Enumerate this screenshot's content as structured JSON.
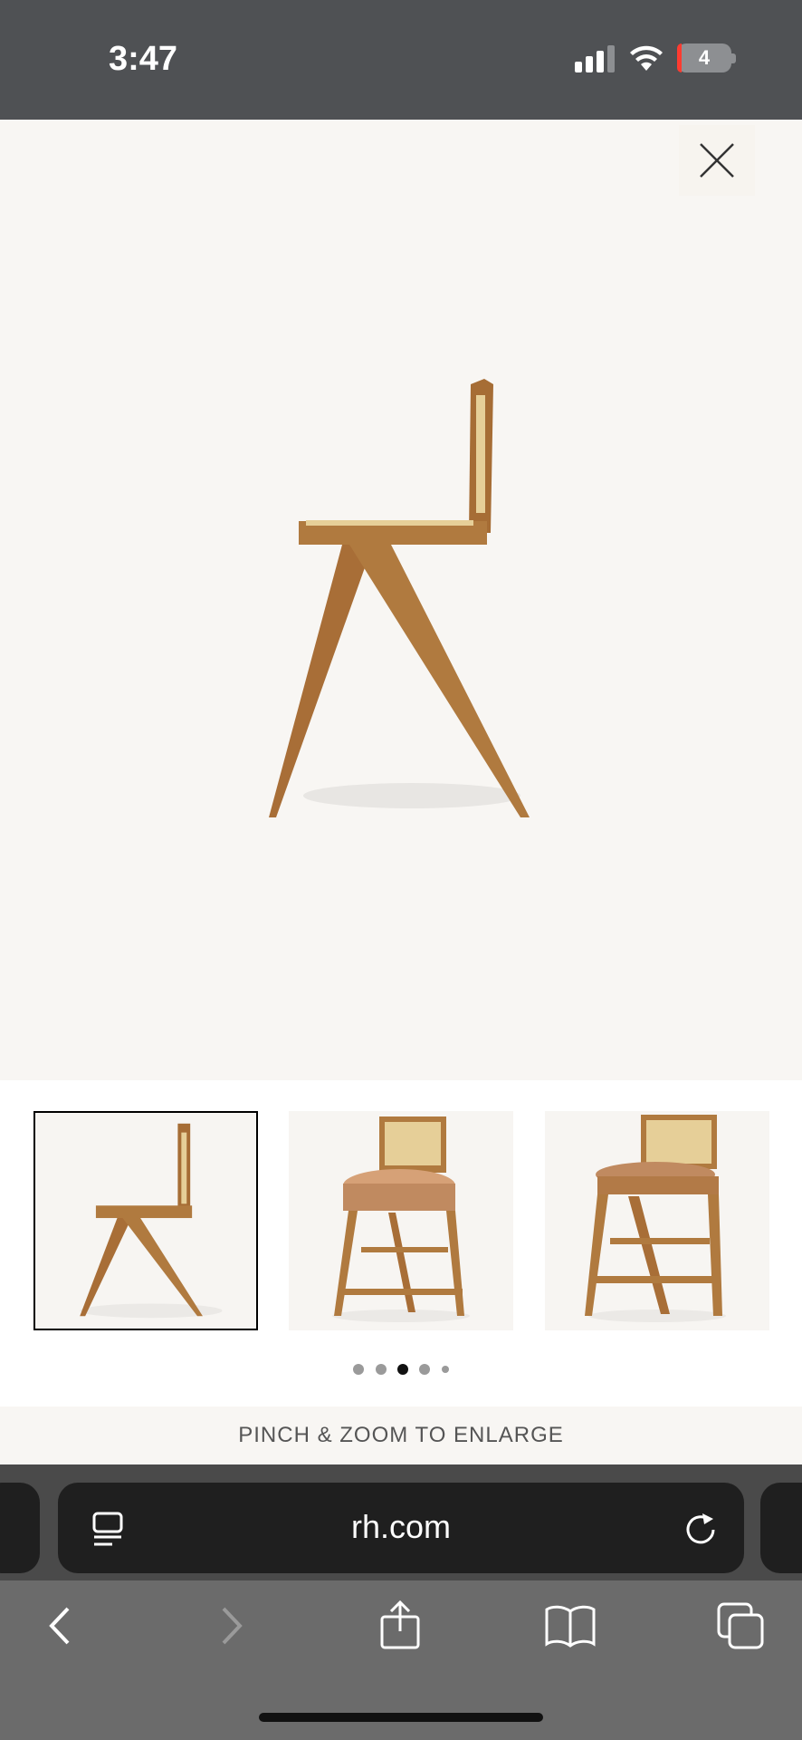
{
  "status_bar": {
    "time": "3:47",
    "battery_level": "4"
  },
  "viewer": {
    "close_icon": "close-icon",
    "main_image_alt": "side-view-cane-counter-stool"
  },
  "thumbnails": [
    {
      "name": "stool-side-view",
      "active": true
    },
    {
      "name": "stool-cushion-front",
      "active": false
    },
    {
      "name": "stool-cushion-angle",
      "active": false
    }
  ],
  "pager": {
    "total": 5,
    "active_index": 2
  },
  "hint": {
    "text": "PINCH & ZOOM TO ENLARGE"
  },
  "browser": {
    "url": "rh.com",
    "icons": [
      "reader-icon",
      "reload-icon",
      "back-icon",
      "forward-icon",
      "share-icon",
      "bookmarks-icon",
      "tabs-icon"
    ]
  },
  "colors": {
    "wood": "#b07a3f",
    "cane": "#e6cf98",
    "cushion": "#c08a60"
  }
}
